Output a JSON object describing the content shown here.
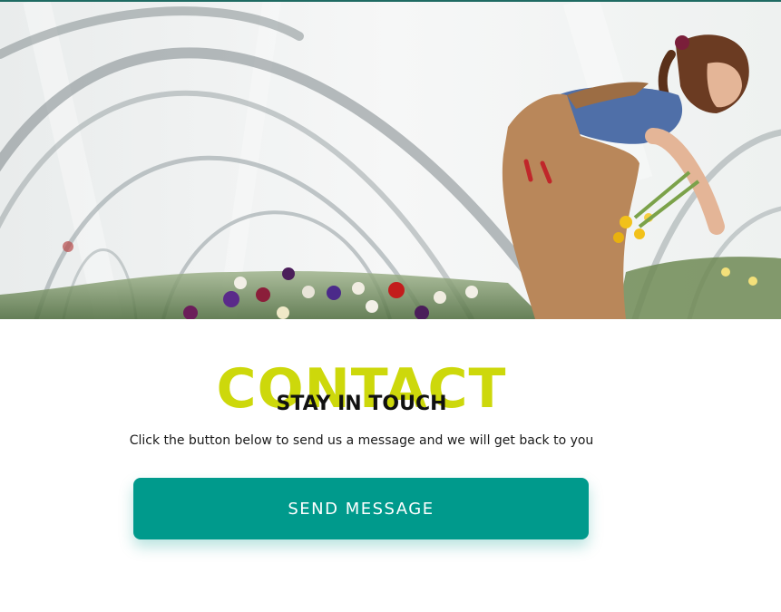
{
  "hero": {
    "image_description_icon": "greenhouse-flower-harvest-photo"
  },
  "contact": {
    "big_word": "CONTACT",
    "heading": "STAY IN TOUCH",
    "description": "Click the button below to send us a message and we will get back to you",
    "button_label": "SEND MESSAGE"
  },
  "colors": {
    "accent_lime": "#cdd80b",
    "button_teal": "#009a8c",
    "top_rule": "#1f6b63"
  }
}
